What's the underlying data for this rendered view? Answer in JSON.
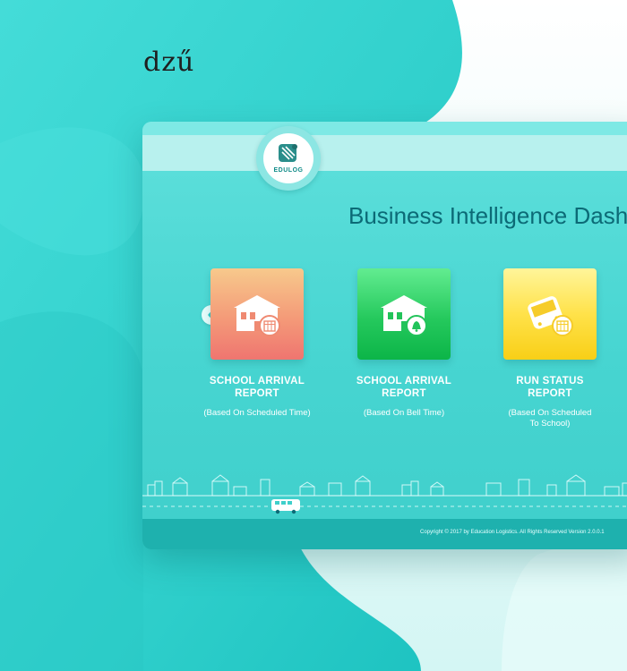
{
  "brand": {
    "logo_text": "dzű"
  },
  "app": {
    "logo_label": "EDULOG",
    "title": "Business Intelligence Dashboard"
  },
  "carousel": {
    "prev_icon": "chevron-left-icon",
    "cards": [
      {
        "title_line1": "SCHOOL ARRIVAL",
        "title_line2": "REPORT",
        "subtitle": "(Based On Scheduled Time)",
        "icon": "school-calendar-icon",
        "colors": [
          "#f7c98c",
          "#ef7570"
        ]
      },
      {
        "title_line1": "SCHOOL ARRIVAL",
        "title_line2": "REPORT",
        "subtitle": "(Based On Bell Time)",
        "icon": "school-bell-icon",
        "colors": [
          "#62ec90",
          "#0cb548"
        ]
      },
      {
        "title_line1": "RUN STATUS",
        "title_line2": "REPORT",
        "subtitle_line1": "(Based On Scheduled",
        "subtitle_line2": "To School)",
        "icon": "bus-calendar-icon",
        "colors": [
          "#fff59a",
          "#f8cf17"
        ]
      }
    ]
  },
  "footer": {
    "copyright": "Copyright © 2017 by Education Logistics. All Rights Reserved Version 2.0.0.1"
  },
  "colors": {
    "teal_accent": "#2ecfcc",
    "title_text": "#0c6a76",
    "footer_bar": "#1eb1ae"
  }
}
